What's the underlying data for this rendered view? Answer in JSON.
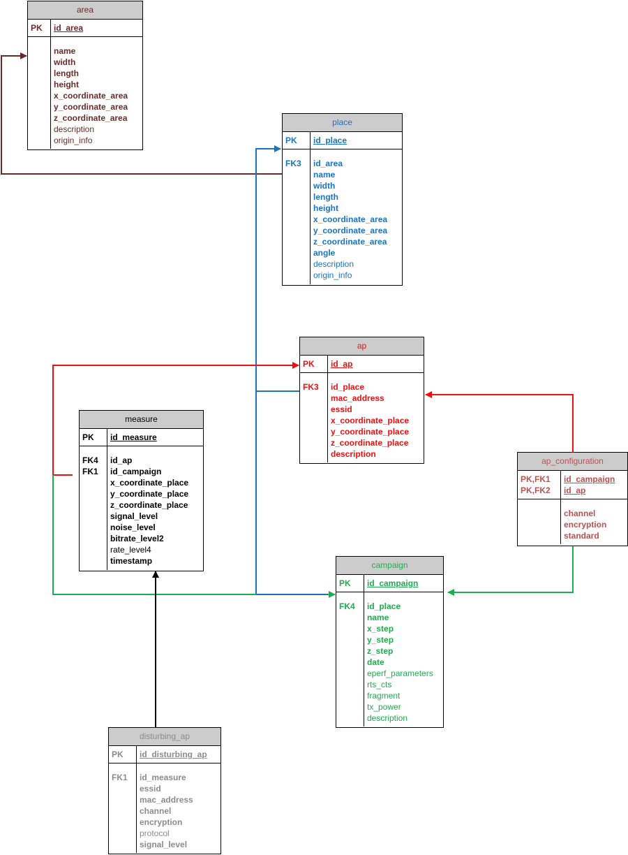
{
  "colors": {
    "area": "#6b2a2a",
    "place": "#1a74c4",
    "ap": "#ee1111",
    "measure": "#000000",
    "ap_configuration": "#c0504d",
    "campaign": "#1fae4f",
    "disturbing_ap": "#8c8c8c",
    "header_bg": "#cccccc"
  },
  "entities": {
    "area": {
      "title": "area",
      "pk_key": "PK",
      "pk_fields": [
        "id_area"
      ],
      "fk_keys": "",
      "fields": [
        {
          "name": "name",
          "bold": true
        },
        {
          "name": "width",
          "bold": true
        },
        {
          "name": "length",
          "bold": true
        },
        {
          "name": "height",
          "bold": true
        },
        {
          "name": "x_coordinate_area",
          "bold": true
        },
        {
          "name": "y_coordinate_area",
          "bold": true
        },
        {
          "name": "z_coordinate_area",
          "bold": true
        },
        {
          "name": "description",
          "bold": false
        },
        {
          "name": "origin_info",
          "bold": false
        }
      ]
    },
    "place": {
      "title": "place",
      "pk_key": "PK",
      "pk_fields": [
        "id_place"
      ],
      "fk_keys": "FK3",
      "fields": [
        {
          "name": "id_area",
          "bold": true
        },
        {
          "name": "name",
          "bold": true
        },
        {
          "name": "width",
          "bold": true
        },
        {
          "name": "length",
          "bold": true
        },
        {
          "name": "height",
          "bold": true
        },
        {
          "name": "x_coordinate_area",
          "bold": true
        },
        {
          "name": "y_coordinate_area",
          "bold": true
        },
        {
          "name": "z_coordinate_area",
          "bold": true
        },
        {
          "name": "angle",
          "bold": true
        },
        {
          "name": "description",
          "bold": false
        },
        {
          "name": "origin_info",
          "bold": false
        }
      ]
    },
    "ap": {
      "title": "ap",
      "pk_key": "PK",
      "pk_fields": [
        "id_ap"
      ],
      "fk_keys": "FK3",
      "fields": [
        {
          "name": "id_place",
          "bold": true
        },
        {
          "name": "mac_address",
          "bold": true
        },
        {
          "name": "essid",
          "bold": true
        },
        {
          "name": "x_coordinate_place",
          "bold": true
        },
        {
          "name": "y_coordinate_place",
          "bold": true
        },
        {
          "name": "z_coordinate_place",
          "bold": true
        },
        {
          "name": "description",
          "bold": true
        }
      ]
    },
    "measure": {
      "title": "measure",
      "pk_key": "PK",
      "pk_fields": [
        "id_measure"
      ],
      "fk_keys": "FK4\nFK1",
      "fields": [
        {
          "name": "id_ap",
          "bold": true
        },
        {
          "name": "id_campaign",
          "bold": true
        },
        {
          "name": "x_coordinate_place",
          "bold": true
        },
        {
          "name": "y_coordinate_place",
          "bold": true
        },
        {
          "name": "z_coordinate_place",
          "bold": true
        },
        {
          "name": "signal_level",
          "bold": true
        },
        {
          "name": "noise_level",
          "bold": true
        },
        {
          "name": "bitrate_level2",
          "bold": true
        },
        {
          "name": "rate_level4",
          "bold": false
        },
        {
          "name": "timestamp",
          "bold": true
        }
      ]
    },
    "ap_configuration": {
      "title": "ap_configuration",
      "pk_key": "PK,FK1\nPK,FK2",
      "pk_fields": [
        "id_campaign",
        "id_ap"
      ],
      "fk_keys": "",
      "fields": [
        {
          "name": "channel",
          "bold": true
        },
        {
          "name": "encryption",
          "bold": true
        },
        {
          "name": "standard",
          "bold": true
        }
      ]
    },
    "campaign": {
      "title": "campaign",
      "pk_key": "PK",
      "pk_fields": [
        "id_campaign"
      ],
      "fk_keys": "FK4",
      "fields": [
        {
          "name": "id_place",
          "bold": true
        },
        {
          "name": "name",
          "bold": true
        },
        {
          "name": "x_step",
          "bold": true
        },
        {
          "name": "y_step",
          "bold": true
        },
        {
          "name": "z_step",
          "bold": true
        },
        {
          "name": "date",
          "bold": true
        },
        {
          "name": "eperf_parameters",
          "bold": false
        },
        {
          "name": "rts_cts",
          "bold": false
        },
        {
          "name": "fragment",
          "bold": false
        },
        {
          "name": "tx_power",
          "bold": false
        },
        {
          "name": "description",
          "bold": false
        }
      ]
    },
    "disturbing_ap": {
      "title": "disturbing_ap",
      "pk_key": "PK",
      "pk_fields": [
        "id_disturbing_ap"
      ],
      "fk_keys": "FK1",
      "fields": [
        {
          "name": "id_measure",
          "bold": true
        },
        {
          "name": "essid",
          "bold": true
        },
        {
          "name": "mac_address",
          "bold": true
        },
        {
          "name": "channel",
          "bold": true
        },
        {
          "name": "encryption",
          "bold": true
        },
        {
          "name": "protocol",
          "bold": false
        },
        {
          "name": "signal_level",
          "bold": true
        }
      ]
    }
  },
  "relationships": [
    {
      "from": "place",
      "to": "area",
      "label": "place.id_area → area.id_area",
      "color_key": "area"
    },
    {
      "from": "ap",
      "to": "place",
      "label": "ap.id_place → place.id_place",
      "color_key": "place"
    },
    {
      "from": "campaign",
      "to": "place",
      "label": "campaign.id_place → place.id_place",
      "color_key": "place"
    },
    {
      "from": "measure",
      "to": "ap",
      "label": "measure.id_ap → ap.id_ap",
      "color_key": "ap"
    },
    {
      "from": "measure",
      "to": "campaign",
      "label": "measure.id_campaign → campaign.id_campaign",
      "color_key": "campaign"
    },
    {
      "from": "ap_configuration",
      "to": "ap",
      "label": "ap_configuration.id_ap → ap.id_ap",
      "color_key": "ap"
    },
    {
      "from": "ap_configuration",
      "to": "campaign",
      "label": "ap_configuration.id_campaign → campaign.id_campaign",
      "color_key": "campaign"
    },
    {
      "from": "disturbing_ap",
      "to": "measure",
      "label": "disturbing_ap.id_measure → measure.id_measure",
      "color_key": "measure"
    }
  ]
}
